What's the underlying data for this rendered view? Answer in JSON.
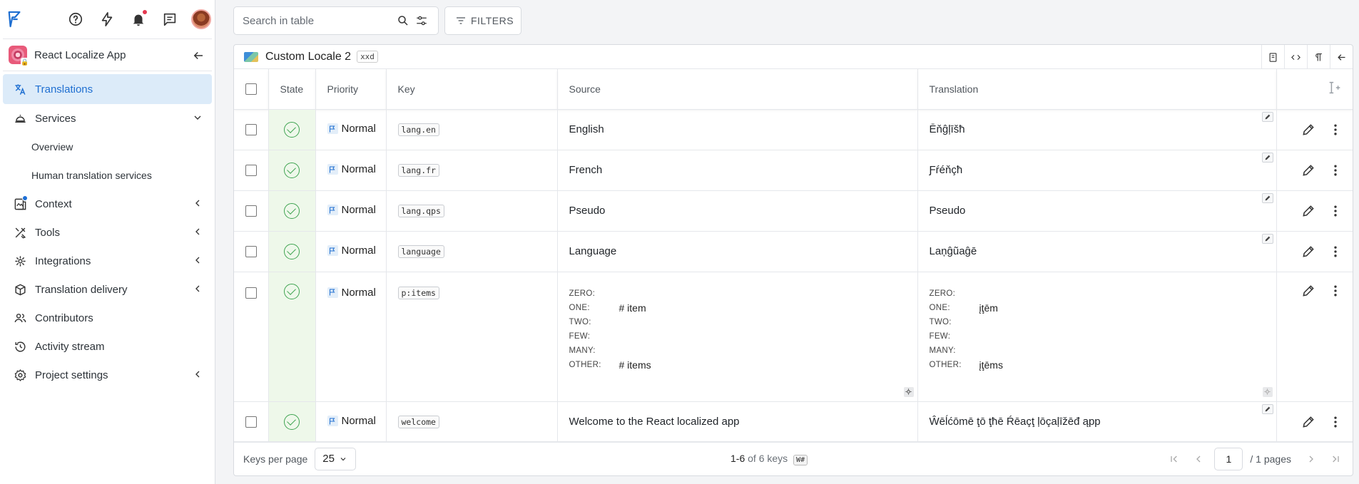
{
  "sidebar": {
    "project": {
      "name": "React Localize App"
    },
    "items": [
      {
        "label": "Translations",
        "active": true
      },
      {
        "label": "Services",
        "expanded": true
      },
      {
        "label": "Overview",
        "sub": true
      },
      {
        "label": "Human translation services",
        "sub": true
      },
      {
        "label": "Context"
      },
      {
        "label": "Tools"
      },
      {
        "label": "Integrations"
      },
      {
        "label": "Translation delivery"
      },
      {
        "label": "Contributors"
      },
      {
        "label": "Activity stream"
      },
      {
        "label": "Project settings"
      }
    ]
  },
  "toolbar": {
    "search_placeholder": "Search in table",
    "filters_label": "FILTERS"
  },
  "table": {
    "locale_name": "Custom Locale 2",
    "locale_code": "xxd",
    "columns": [
      "State",
      "Priority",
      "Key",
      "Source",
      "Translation"
    ],
    "rows": [
      {
        "priority": "Normal",
        "key": "lang.en",
        "source": "English",
        "translation": "Ēňĝļīšħ"
      },
      {
        "priority": "Normal",
        "key": "lang.fr",
        "source": "French",
        "translation": "Ƒŕéňçħ"
      },
      {
        "priority": "Normal",
        "key": "lang.qps",
        "source": "Pseudo",
        "translation": "Pseudo"
      },
      {
        "priority": "Normal",
        "key": "language",
        "source": "Language",
        "translation": "Laņĝũaĝē"
      },
      {
        "priority": "Normal",
        "key": "p:items",
        "plural_labels": [
          "ZERO:",
          "ONE:",
          "TWO:",
          "FEW:",
          "MANY:",
          "OTHER:"
        ],
        "source_plural": [
          "",
          "# item",
          "",
          "",
          "",
          "# items"
        ],
        "translation_plural": [
          "",
          "įţēm",
          "",
          "",
          "",
          "įţēms"
        ]
      },
      {
        "priority": "Normal",
        "key": "welcome",
        "source": "Welcome to the React localized app",
        "translation": "Ŵēĺćōmē ţō ţħē Ŕēaçţ ļōçaļīžēđ ąpp"
      }
    ]
  },
  "footer": {
    "keys_per_page_label": "Keys per page",
    "keys_per_page_value": "25",
    "range": "1-6",
    "range_of": "of 6 keys",
    "badge": "W#",
    "page": "1",
    "pages_total": "/ 1 pages"
  },
  "colors": {
    "accent": "#1f6fd1",
    "active_bg": "#dcebf9",
    "state_bg": "#eef8ea",
    "state_ok": "#3fa451",
    "notification": "#e53950"
  }
}
